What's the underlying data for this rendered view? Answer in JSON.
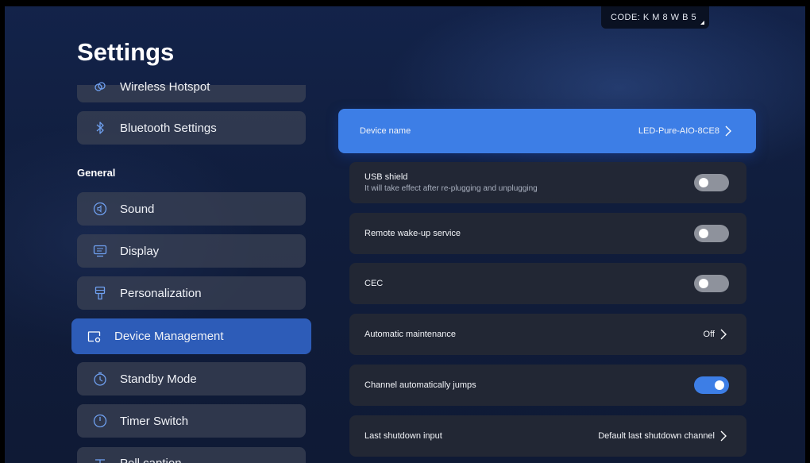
{
  "header": {
    "code_label": "CODE: K M 8 W B 5",
    "title": "Settings"
  },
  "sidebar": {
    "section_general": "General",
    "items": [
      {
        "label": "Wireless Hotspot",
        "icon": "hotspot-icon"
      },
      {
        "label": "Bluetooth Settings",
        "icon": "bluetooth-icon"
      },
      {
        "label": "Sound",
        "icon": "sound-icon"
      },
      {
        "label": "Display",
        "icon": "display-icon"
      },
      {
        "label": "Personalization",
        "icon": "personalization-icon"
      },
      {
        "label": "Device Management",
        "icon": "device-management-icon",
        "active": true
      },
      {
        "label": "Standby Mode",
        "icon": "standby-icon"
      },
      {
        "label": "Timer Switch",
        "icon": "power-icon"
      },
      {
        "label": "Poll caption",
        "icon": "caption-icon"
      }
    ]
  },
  "settings": {
    "device_name": {
      "label": "Device name",
      "value": "LED-Pure-AIO-8CE8"
    },
    "usb_shield": {
      "label": "USB shield",
      "sub": "It will take effect after re-plugging and unplugging",
      "enabled": false
    },
    "remote_wakeup": {
      "label": "Remote wake-up service",
      "enabled": false
    },
    "cec": {
      "label": "CEC",
      "enabled": false
    },
    "auto_maintenance": {
      "label": "Automatic maintenance",
      "value": "Off"
    },
    "channel_jumps": {
      "label": "Channel automatically jumps",
      "enabled": true
    },
    "last_shutdown": {
      "label": "Last shutdown input",
      "value": "Default last shutdown channel"
    }
  },
  "colors": {
    "accent": "#3d7ee6",
    "active_menu": "#2d5cb8",
    "toggle_off": "#8e929c"
  }
}
